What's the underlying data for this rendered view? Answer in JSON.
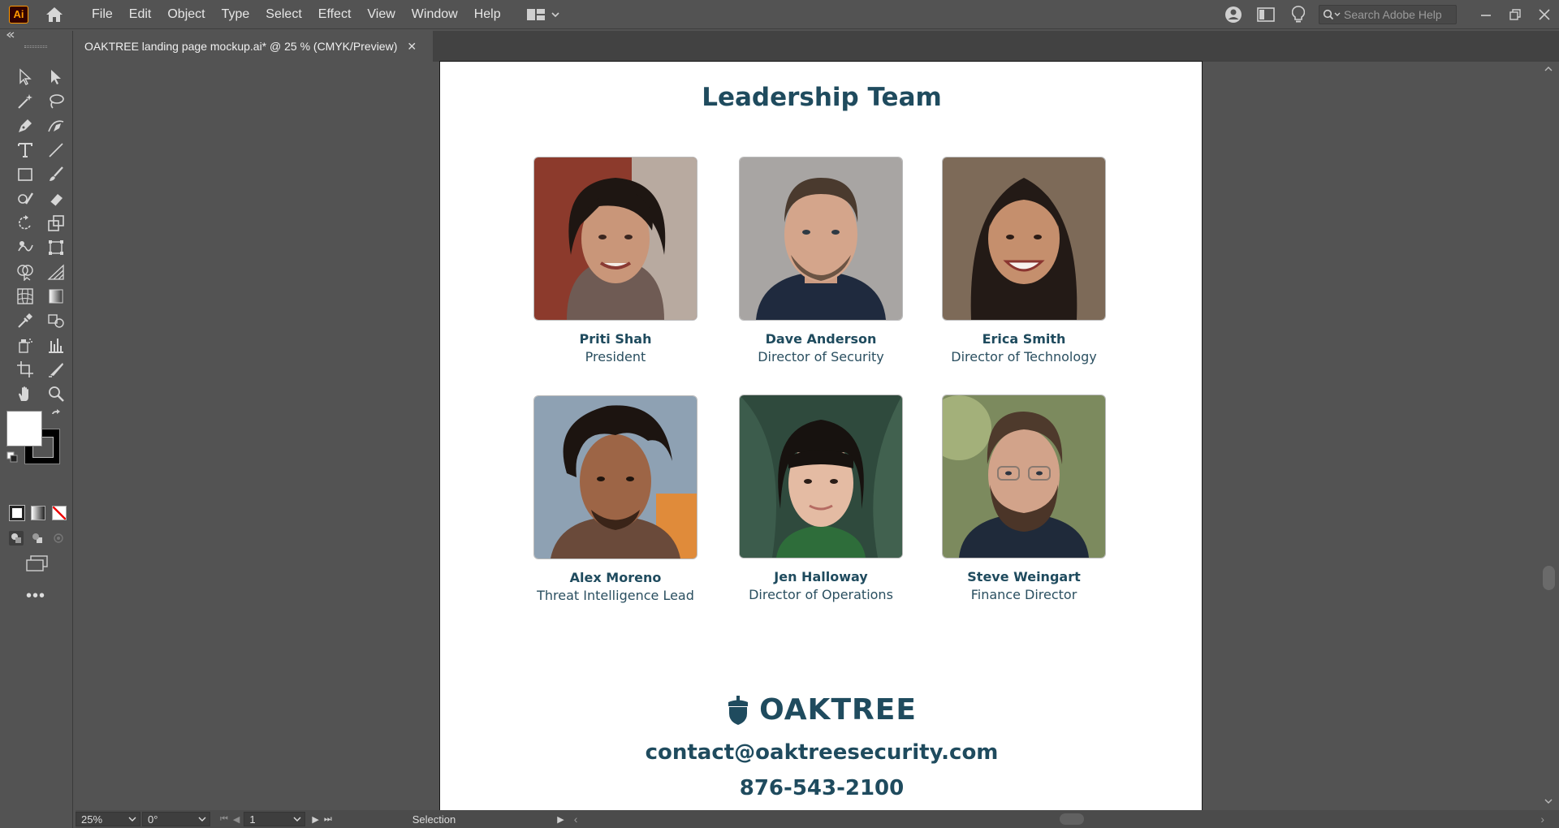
{
  "app": {
    "logo_text": "Ai",
    "menus": [
      "File",
      "Edit",
      "Object",
      "Type",
      "Select",
      "Effect",
      "View",
      "Window",
      "Help"
    ],
    "search_placeholder": "Search Adobe Help"
  },
  "document": {
    "tab_title": "OAKTREE landing page mockup.ai* @ 25 % (CMYK/Preview)",
    "close_glyph": "✕"
  },
  "artboard": {
    "heading": "Leadership Team",
    "members": [
      {
        "name": "Priti Shah",
        "role": "President"
      },
      {
        "name": "Dave Anderson",
        "role": "Director of Security"
      },
      {
        "name": "Erica Smith",
        "role": "Director of Technology"
      },
      {
        "name": "Alex Moreno",
        "role": "Threat Intelligence Lead"
      },
      {
        "name": "Jen Halloway",
        "role": "Director of Operations"
      },
      {
        "name": "Steve Weingart",
        "role": "Finance Director"
      }
    ],
    "logo_text": "OAKTREE",
    "email": "contact@oaktreesecurity.com",
    "phone": "876-543-2100"
  },
  "status": {
    "zoom": "25%",
    "rotation": "0°",
    "artboard_number": "1",
    "tool": "Selection"
  },
  "colors": {
    "brand": "#1f4b5e",
    "chrome": "#535353"
  }
}
